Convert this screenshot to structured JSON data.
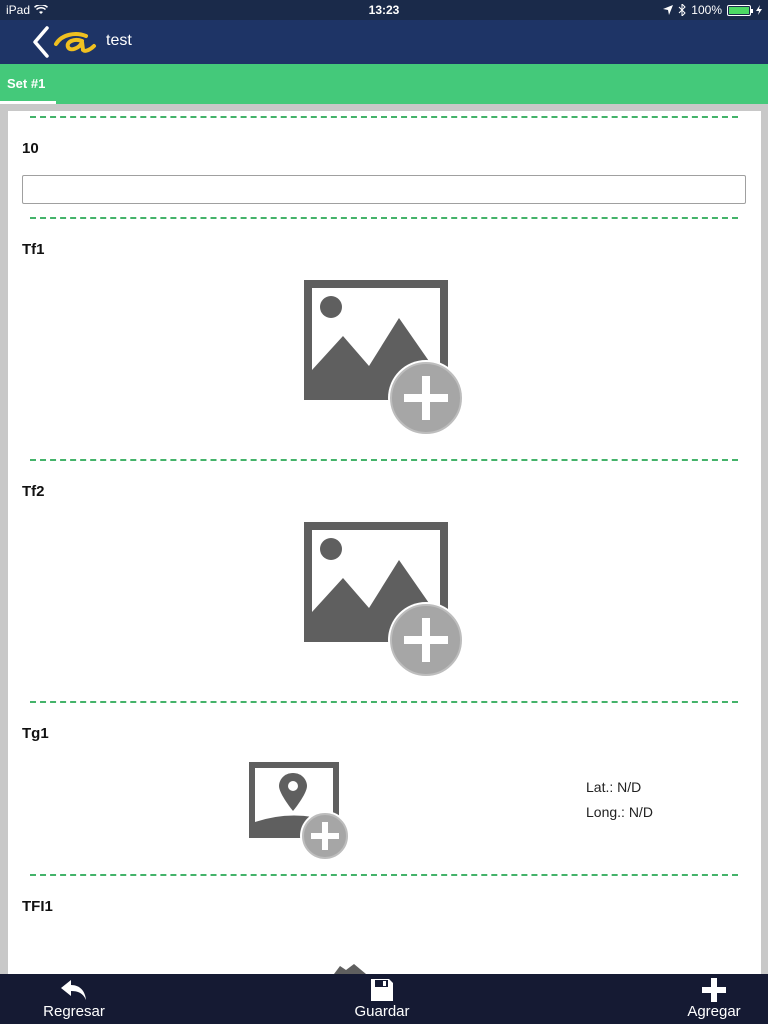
{
  "status_bar": {
    "device": "iPad",
    "time": "13:23",
    "battery": "100%"
  },
  "navbar": {
    "title": "test"
  },
  "tabs": [
    {
      "label": "Set #1",
      "active": true
    }
  ],
  "form": {
    "fields": [
      {
        "label": "10",
        "type": "text",
        "value": ""
      },
      {
        "label": "Tf1",
        "type": "image"
      },
      {
        "label": "Tf2",
        "type": "image"
      },
      {
        "label": "Tg1",
        "type": "geo-image",
        "lat": "Lat.: N/D",
        "long": "Long.: N/D"
      },
      {
        "label": "TFI1",
        "type": "file"
      }
    ]
  },
  "toolbar": {
    "back_label": "Regresar",
    "save_label": "Guardar",
    "add_label": "Agregar"
  },
  "colors": {
    "navbar": "#1e3466",
    "tabstrip": "#44c97a",
    "toolbar": "#151a33",
    "divider": "#44b36a"
  }
}
